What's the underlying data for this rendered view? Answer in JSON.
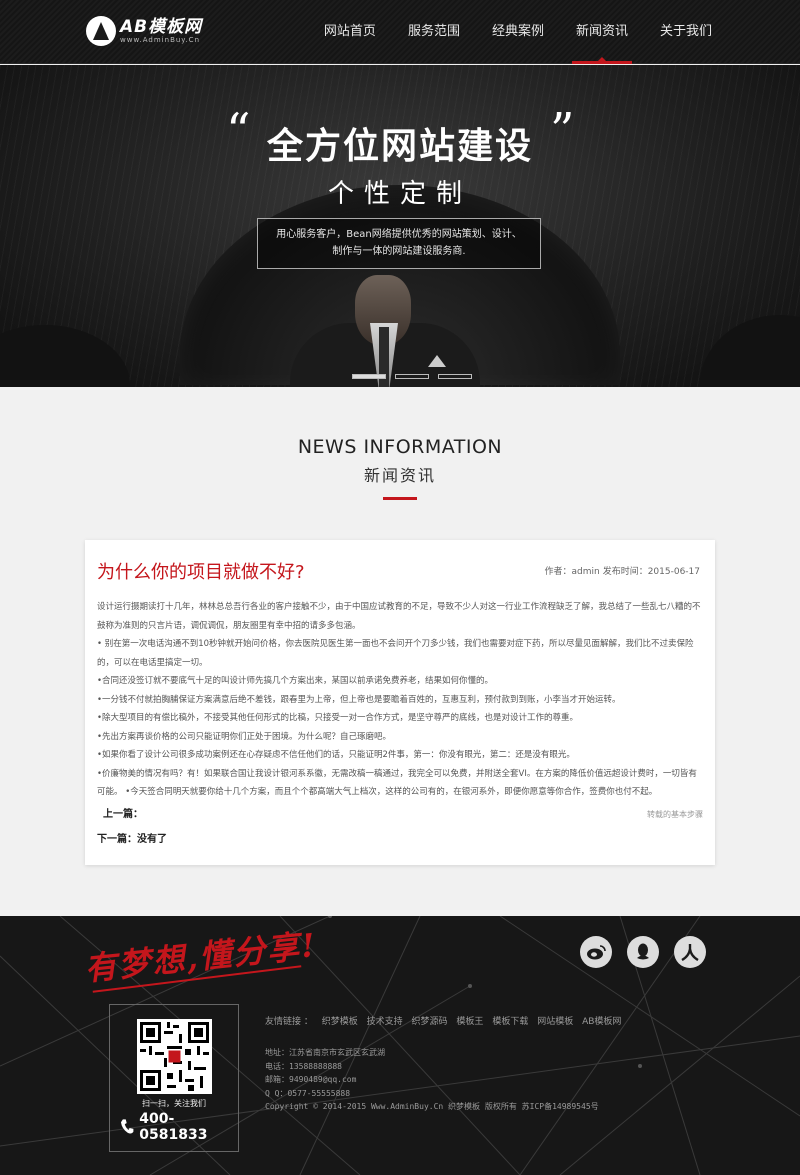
{
  "header": {
    "logo_name": "AB模板网",
    "logo_url": "www.AdminBuy.Cn",
    "nav": [
      {
        "label": "网站首页"
      },
      {
        "label": "服务范围"
      },
      {
        "label": "经典案例"
      },
      {
        "label": "新闻资讯",
        "active": true
      },
      {
        "label": "关于我们"
      }
    ]
  },
  "banner": {
    "quote_open": "“",
    "quote_close": "”",
    "title": "全方位网站建设",
    "subtitle": "个性定制",
    "box_line1": "用心服务客户，Bean网络提供优秀的网站策划、设计、",
    "box_line2": "制作与一体的网站建设服务商.",
    "slides": 3,
    "active_slide": 1
  },
  "section": {
    "title_en": "NEWS INFORMATION",
    "title_cn": "新闻资讯"
  },
  "article": {
    "title": "为什么你的项目就做不好?",
    "author_label": "作者：admin",
    "date_label": "发布时间：2015-06-17",
    "paragraphs": [
      "设计运行摄期读打十几年，林林总总吾行各业的客户接触不少，由于中国应试教育的不足，导致不少人对这一行业工作流程缺乏了解，我总结了一些乱七八糟的不鼓称为准则的只言片语，调侃调侃，朋友圈里有幸中招的请多多包涵。",
      "• 别在第一次电话沟通不到10秒钟就开始问价格，你去医院见医生第一面也不会问开个刀多少钱，我们也需要对症下药，所以尽量见面解解，我们比不过卖保险的，可以在电话里搞定一切。",
      "•合同还没签订就不要底气十足的叫设计师先搞几个方案出来，某国以前承诺免费养老，结果如何你懂的。",
      "•一分钱不付就拍胸脯保证方案满意后绝不差钱，跟春里为上帝，但上帝也是要瞻着百姓的，互惠互利，预付款到到账，小李当才开始运转。",
      "•除大型项目的有偿比稿外，不接受其他任何形式的比稿，只接受一对一合作方式，是坚守尊严的底线，也是对设计工作的尊重。",
      "•先出方案再谈价格的公司只能证明你们正处于困境。为什么呢？自己琢磨吧。",
      "•如果你看了设计公司很多成功案例还在心存疑虑不信任他们的话，只能证明2件事，第一：你没有眼光，第二：还是没有眼光。",
      "•价廉物美的情况有吗？有！如果联合国让我设计银河系系徽，无需改稿一稿通过，我完全可以免费，并附送全套VI。在方案的降低价值远超设计费时，一切皆有可能。 •今天签合同明天就要你给十几个方案，而且个个都高端大气上档次，这样的公司有的，在银河系外，即便你愿意等你合作，签费你也付不起。"
    ],
    "prev_label": "上一篇：",
    "tag_label": "转载的基本步骤",
    "next_label": "下一篇：没有了"
  },
  "footer": {
    "slogan": "有梦想,懂分享!",
    "qr_caption": "扫一扫，关注我们",
    "phone": "400-0581833",
    "links_label": "友情链接 ：",
    "links": [
      "织梦模板",
      "技术支持",
      "织梦源码",
      "模板王",
      "模板下载",
      "网站模板",
      "AB模板网"
    ],
    "address": "地址：江苏省南京市玄武区玄武湖",
    "tel": "电话：13588888888",
    "email": "邮箱：9490489@qq.com",
    "qq": "Q  Q：0577-55555888",
    "copyright": "Copyright © 2014-2015 Www.AdminBuy.Cn 织梦模板 版权所有  苏ICP备14989545号"
  }
}
